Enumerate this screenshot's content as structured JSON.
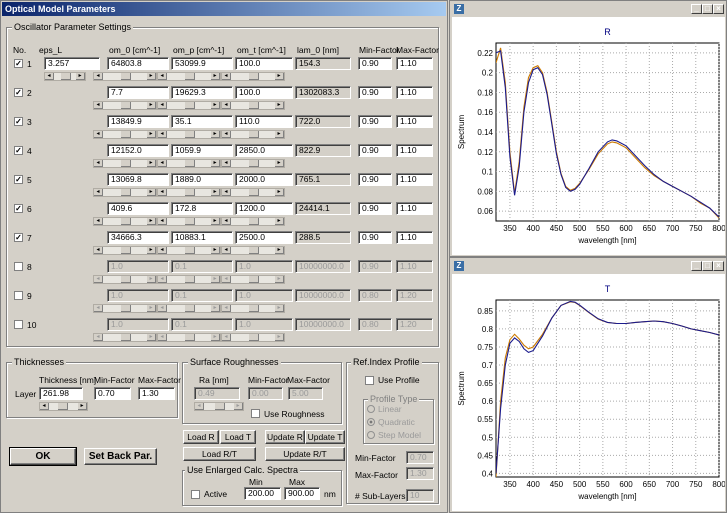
{
  "main_window": {
    "title": "Optical Model Parameters",
    "osc_group_label": "Oscillator Parameter Settings",
    "headers": [
      "No.",
      "eps_L",
      "om_0 [cm^-1]",
      "om_p [cm^-1]",
      "om_t [cm^-1]",
      "lam_0 [nm]",
      "Min-Factor",
      "Max-Factor"
    ],
    "eps_l": "3.257",
    "oscillators": [
      {
        "no": "1",
        "checked": true,
        "om0": "64803.8",
        "omp": "53099.9",
        "omt": "100.0",
        "lam0": "154.3",
        "min": "0.90",
        "max": "1.10"
      },
      {
        "no": "2",
        "checked": true,
        "om0": "7.7",
        "omp": "19629.3",
        "omt": "100.0",
        "lam0": "1302083.3",
        "min": "0.90",
        "max": "1.10"
      },
      {
        "no": "3",
        "checked": true,
        "om0": "13849.9",
        "omp": "35.1",
        "omt": "110.0",
        "lam0": "722.0",
        "min": "0.90",
        "max": "1.10"
      },
      {
        "no": "4",
        "checked": true,
        "om0": "12152.0",
        "omp": "1059.9",
        "omt": "2850.0",
        "lam0": "822.9",
        "min": "0.90",
        "max": "1.10"
      },
      {
        "no": "5",
        "checked": true,
        "om0": "13069.8",
        "omp": "1889.0",
        "omt": "2000.0",
        "lam0": "765.1",
        "min": "0.90",
        "max": "1.10"
      },
      {
        "no": "6",
        "checked": true,
        "om0": "409.6",
        "omp": "172.8",
        "omt": "1200.0",
        "lam0": "24414.1",
        "min": "0.90",
        "max": "1.10"
      },
      {
        "no": "7",
        "checked": true,
        "om0": "34666.3",
        "omp": "10883.1",
        "omt": "2500.0",
        "lam0": "288.5",
        "min": "0.90",
        "max": "1.10"
      },
      {
        "no": "8",
        "checked": false,
        "om0": "1.0",
        "omp": "0.1",
        "omt": "1.0",
        "lam0": "10000000.0",
        "min": "0.90",
        "max": "1.10"
      },
      {
        "no": "9",
        "checked": false,
        "om0": "1.0",
        "omp": "0.1",
        "omt": "1.0",
        "lam0": "10000000.0",
        "min": "0.80",
        "max": "1.20"
      },
      {
        "no": "10",
        "checked": false,
        "om0": "1.0",
        "omp": "0.1",
        "omt": "1.0",
        "lam0": "10000000.0",
        "min": "0.80",
        "max": "1.20"
      }
    ],
    "thickness": {
      "group_label": "Thicknesses",
      "layer_label": "Layer",
      "col_thickness": "Thickness [nm]",
      "col_min": "Min-Factor",
      "col_max": "Max-Factor",
      "value": "261.98",
      "min": "0.70",
      "max": "1.30"
    },
    "roughness": {
      "group_label": "Surface Roughnesses",
      "col_ra": "Ra [nm]",
      "col_min": "Min-Factor",
      "col_max": "Max-Factor",
      "value": "0.49",
      "min": "0.00",
      "max": "5.00",
      "use_label": "Use Roughness"
    },
    "refindex": {
      "group_label": "Ref.Index  Profile",
      "use_label": "Use Profile",
      "profile_type_label": "Profile Type",
      "options": [
        "Linear",
        "Quadratic",
        "Step Model"
      ],
      "min_label": "Min-Factor",
      "min_value": "0.70",
      "max_label": "Max-Factor",
      "max_value": "1.30",
      "sublayers_label": "# Sub-Layers",
      "sublayers_value": "10"
    },
    "buttons": {
      "ok": "OK",
      "set_back": "Set Back Par.",
      "load_r": "Load R",
      "load_t": "Load T",
      "load_rt": "Load R/T",
      "update_r": "Update R",
      "update_t": "Update T",
      "update_rt": "Update R/T"
    },
    "enlarged": {
      "group_label": "Use Enlarged Calc. Spectra",
      "active_label": "Active",
      "min_label": "Min",
      "max_label": "Max",
      "min_value": "200.00",
      "max_value": "900.00",
      "unit": "nm"
    }
  },
  "plot_windows": [
    {
      "title_icon": "Z",
      "chart_title": "R"
    },
    {
      "title_icon": "Z",
      "chart_title": "T"
    }
  ],
  "colors": {
    "measured": "#cc7a00",
    "calculated": "#1a1a8c",
    "title_active": "#0a246a"
  },
  "chart_data": [
    {
      "type": "line",
      "title": "R",
      "xlabel": "wavelength [nm]",
      "ylabel": "Spectrum",
      "xlim": [
        320,
        800
      ],
      "ylim": [
        0.05,
        0.23
      ],
      "xticks": [
        350,
        400,
        450,
        500,
        550,
        600,
        650,
        700,
        750,
        800
      ],
      "yticks": [
        0.06,
        0.08,
        0.1,
        0.12,
        0.14,
        0.16,
        0.18,
        0.2,
        0.22
      ],
      "series": [
        {
          "color": "#cc7a00",
          "x": [
            320,
            330,
            340,
            350,
            360,
            370,
            380,
            390,
            400,
            410,
            420,
            430,
            440,
            450,
            460,
            470,
            480,
            490,
            500,
            520,
            540,
            560,
            570,
            580,
            600,
            620,
            640,
            660,
            680,
            700,
            720,
            740,
            760,
            780,
            800
          ],
          "y": [
            0.21,
            0.225,
            0.19,
            0.12,
            0.078,
            0.11,
            0.165,
            0.195,
            0.205,
            0.207,
            0.2,
            0.18,
            0.15,
            0.12,
            0.098,
            0.085,
            0.081,
            0.083,
            0.088,
            0.102,
            0.118,
            0.128,
            0.13,
            0.129,
            0.124,
            0.114,
            0.104,
            0.096,
            0.09,
            0.085,
            0.08,
            0.075,
            0.068,
            0.063,
            0.053
          ]
        },
        {
          "color": "#1a1a8c",
          "x": [
            320,
            330,
            340,
            350,
            360,
            370,
            380,
            390,
            400,
            410,
            420,
            430,
            440,
            450,
            460,
            470,
            480,
            490,
            500,
            520,
            540,
            560,
            570,
            580,
            600,
            620,
            640,
            660,
            680,
            700,
            720,
            740,
            760,
            780,
            800
          ],
          "y": [
            0.22,
            0.222,
            0.185,
            0.115,
            0.076,
            0.105,
            0.16,
            0.19,
            0.203,
            0.205,
            0.198,
            0.178,
            0.148,
            0.118,
            0.097,
            0.084,
            0.08,
            0.082,
            0.087,
            0.103,
            0.12,
            0.13,
            0.132,
            0.131,
            0.126,
            0.116,
            0.106,
            0.097,
            0.09,
            0.085,
            0.08,
            0.075,
            0.069,
            0.063,
            0.054
          ]
        }
      ]
    },
    {
      "type": "line",
      "title": "T",
      "xlabel": "wavelength [nm]",
      "ylabel": "Spectrum",
      "xlim": [
        320,
        800
      ],
      "ylim": [
        0.39,
        0.88
      ],
      "xticks": [
        350,
        400,
        450,
        500,
        550,
        600,
        650,
        700,
        750,
        800
      ],
      "yticks": [
        0.4,
        0.45,
        0.5,
        0.55,
        0.6,
        0.65,
        0.7,
        0.75,
        0.8,
        0.85
      ],
      "series": [
        {
          "color": "#cc7a00",
          "x": [
            320,
            330,
            340,
            350,
            360,
            370,
            380,
            390,
            400,
            420,
            440,
            460,
            480,
            490,
            500,
            520,
            540,
            560,
            580,
            600,
            620,
            640,
            660,
            680,
            700,
            720,
            740,
            760,
            780,
            800
          ],
          "y": [
            0.39,
            0.6,
            0.72,
            0.77,
            0.785,
            0.772,
            0.755,
            0.745,
            0.75,
            0.785,
            0.83,
            0.865,
            0.875,
            0.873,
            0.865,
            0.845,
            0.827,
            0.818,
            0.815,
            0.815,
            0.818,
            0.82,
            0.822,
            0.82,
            0.815,
            0.808,
            0.8,
            0.795,
            0.79,
            0.783
          ]
        },
        {
          "color": "#1a1a8c",
          "x": [
            320,
            330,
            340,
            350,
            360,
            370,
            380,
            390,
            400,
            420,
            440,
            460,
            480,
            490,
            500,
            520,
            540,
            560,
            580,
            600,
            620,
            640,
            660,
            680,
            700,
            720,
            740,
            760,
            780,
            800
          ],
          "y": [
            0.4,
            0.58,
            0.7,
            0.76,
            0.775,
            0.765,
            0.745,
            0.735,
            0.74,
            0.78,
            0.83,
            0.865,
            0.876,
            0.874,
            0.866,
            0.846,
            0.828,
            0.818,
            0.815,
            0.815,
            0.818,
            0.82,
            0.822,
            0.82,
            0.815,
            0.808,
            0.8,
            0.795,
            0.79,
            0.783
          ]
        }
      ]
    }
  ]
}
